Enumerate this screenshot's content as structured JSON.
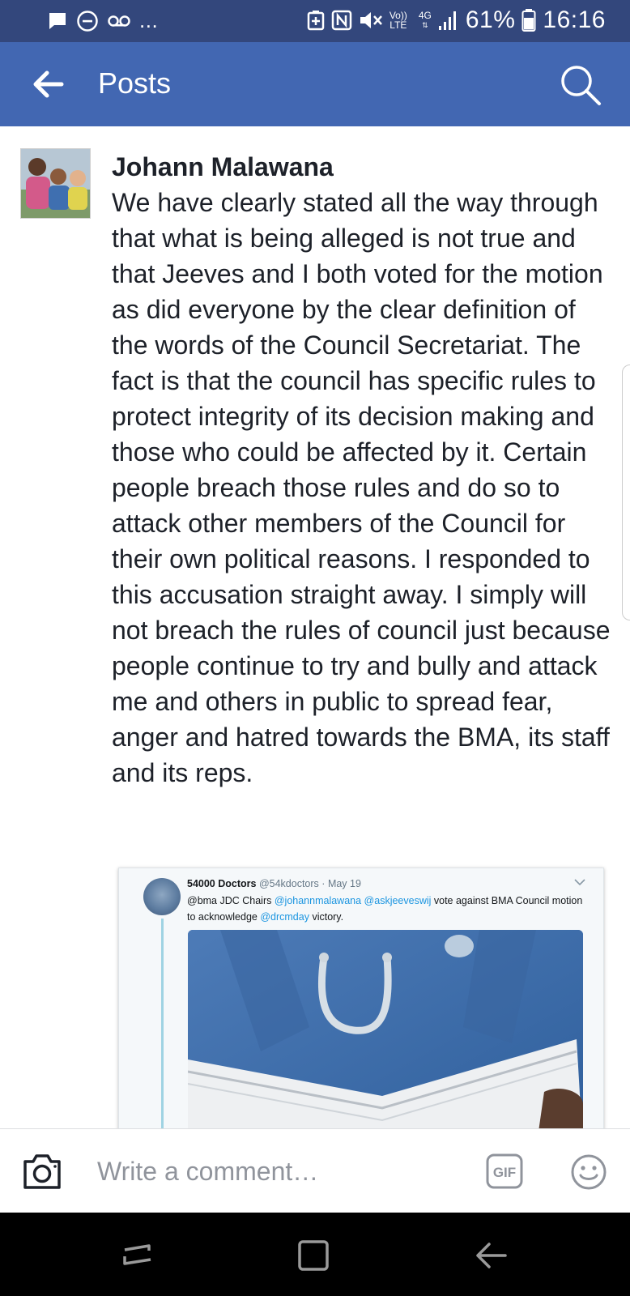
{
  "status_bar": {
    "battery": "61%",
    "time": "16:16",
    "network": "4G",
    "volte": [
      "Vo))",
      "LTE"
    ],
    "more": "...",
    "icons": [
      "message-icon",
      "do-not-disturb-icon",
      "voicemail-icon",
      "battery-saver-icon",
      "nfc-icon",
      "mute-icon",
      "volte-icon",
      "4g-icon",
      "signal-icon",
      "battery-icon"
    ]
  },
  "app_bar": {
    "title": "Posts",
    "icons": [
      "back-arrow-icon",
      "search-icon"
    ]
  },
  "post": {
    "author": "Johann Malawana",
    "body": "We have clearly stated all the way through that what is being alleged is not true and that Jeeves and I both voted for the motion as did everyone by the clear definition of the words of the Council Secretariat. The fact is that the council has specific rules to protect integrity of its decision making and those who could be affected by it. Certain people breach those rules and do so to attack other members of the Council for their own political reasons. I responded to this accusation straight away. I simply will not breach the rules of council just because people continue to try and bully and attack me and others in public to spread fear, anger and hatred towards the BMA, its staff and its reps."
  },
  "tweet": {
    "name": "54000 Doctors",
    "handle": "@54kdoctors",
    "separator": "·",
    "date": "May 19",
    "text_1": "@bma JDC Chairs ",
    "mention_1": "@johannmalawana",
    "space": " ",
    "mention_2": "@askjeeveswij",
    "text_2": " vote against BMA Council motion to acknowledge ",
    "mention_3": "@drcmday",
    "text_3": " victory."
  },
  "comment_bar": {
    "placeholder": "Write a comment…",
    "gif_label": "GIF",
    "icons": [
      "camera-icon",
      "gif-icon",
      "emoji-icon"
    ]
  },
  "nav_bar": {
    "icons": [
      "recent-apps-icon",
      "home-icon",
      "back-icon"
    ]
  },
  "colors": {
    "status_bar": "#33477c",
    "app_bar": "#4267b2",
    "text": "#1d2129",
    "mention": "#1b95e0",
    "nav_bar": "#000000"
  }
}
